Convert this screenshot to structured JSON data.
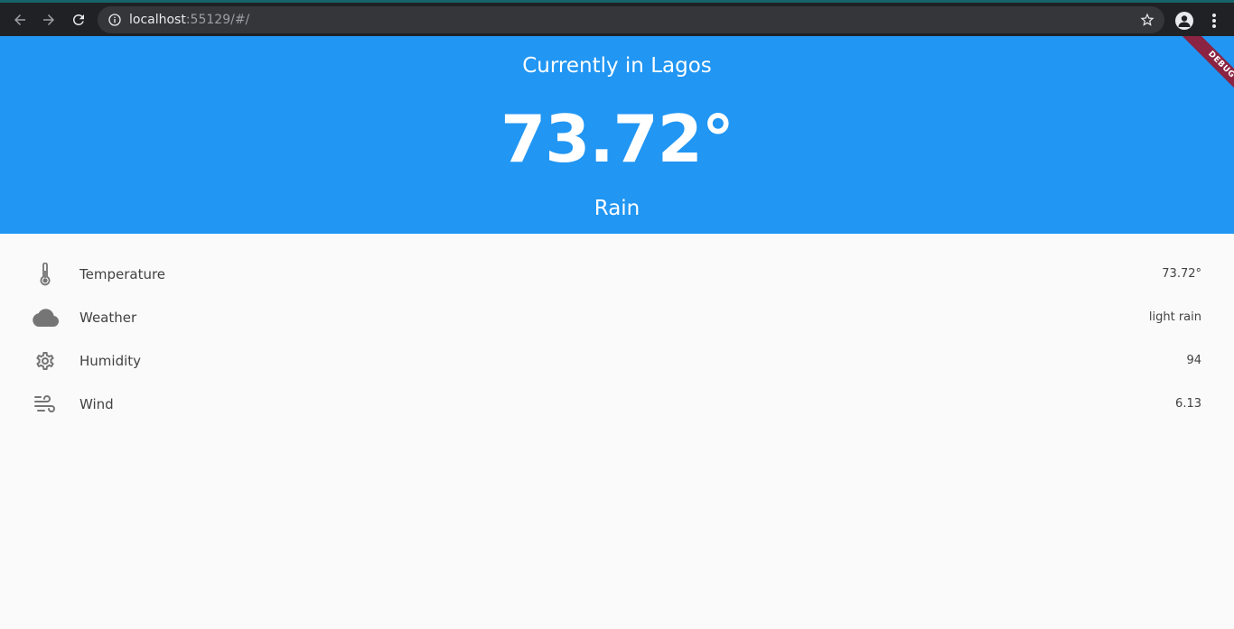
{
  "browser": {
    "url_host": "localhost",
    "url_rest": ":55129/#/",
    "icons": {
      "back": "arrow-left-icon",
      "forward": "arrow-right-icon",
      "reload": "reload-icon",
      "info": "info-icon",
      "star": "star-icon",
      "profile": "profile-icon",
      "menu": "kebab-menu-icon"
    }
  },
  "header": {
    "location": "Currently in Lagos",
    "temperature": "73.72°",
    "condition": "Rain",
    "debug_banner": "DEBUG",
    "background_color": "#2196f3"
  },
  "details": {
    "rows": [
      {
        "icon": "thermometer-icon",
        "label": "Temperature",
        "value": "73.72°"
      },
      {
        "icon": "cloud-icon",
        "label": "Weather",
        "value": "light rain"
      },
      {
        "icon": "gear-icon",
        "label": "Humidity",
        "value": "94"
      },
      {
        "icon": "wind-icon",
        "label": "Wind",
        "value": "6.13"
      }
    ]
  }
}
